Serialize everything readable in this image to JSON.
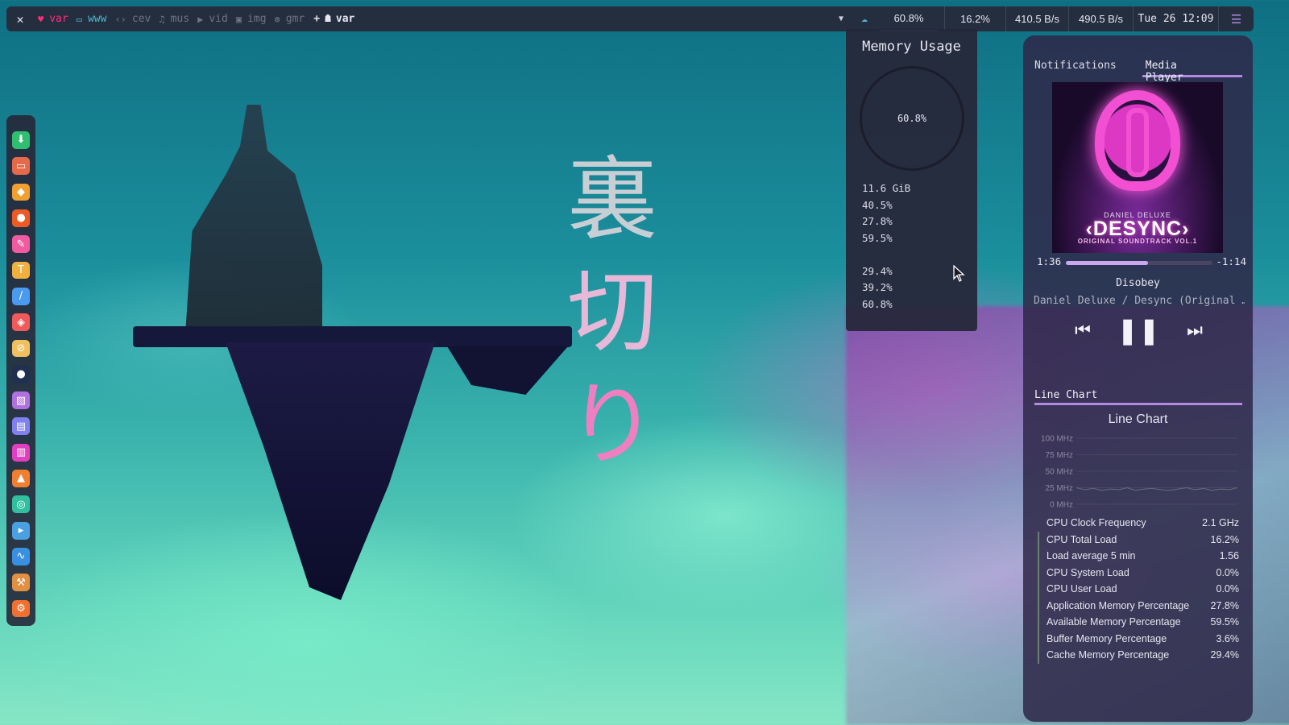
{
  "wallpaper": {
    "kanji": [
      "裏",
      "切",
      "り"
    ]
  },
  "topbar": {
    "workspaces": [
      {
        "icon": "heart-icon",
        "glyph": "♥",
        "label": "var",
        "state": "active"
      },
      {
        "icon": "window-icon",
        "glyph": "▭",
        "label": "www",
        "state": "occupied"
      },
      {
        "icon": "code-icon",
        "glyph": "‹›",
        "label": "cev",
        "state": "empty"
      },
      {
        "icon": "music-icon",
        "glyph": "♫",
        "label": "mus",
        "state": "empty"
      },
      {
        "icon": "video-icon",
        "glyph": "▶",
        "label": "vid",
        "state": "empty"
      },
      {
        "icon": "image-icon",
        "glyph": "▣",
        "label": "img",
        "state": "empty"
      },
      {
        "icon": "gamepad-icon",
        "glyph": "⊛",
        "label": "gmr",
        "state": "empty"
      }
    ],
    "layout_label": "var",
    "memory": "60.8%",
    "cpu": "16.2%",
    "net_down": "410.5 B/s",
    "net_up": "490.5 B/s",
    "clock": "Tue 26  12:09"
  },
  "dock": {
    "items": [
      {
        "icon": "download-icon",
        "glyph": "⬇",
        "color": "#2fbf71"
      },
      {
        "icon": "folder-icon",
        "glyph": "▭",
        "color": "#e46a4a"
      },
      {
        "icon": "brave-icon",
        "glyph": "◆",
        "color": "#f0a030"
      },
      {
        "icon": "firefox-icon",
        "glyph": "●",
        "color": "#ee5a24"
      },
      {
        "icon": "editor-icon",
        "glyph": "✎",
        "color": "#f05aa0"
      },
      {
        "icon": "text-icon",
        "glyph": "T",
        "color": "#f0b040"
      },
      {
        "icon": "brush-icon",
        "glyph": "/",
        "color": "#4a9af0"
      },
      {
        "icon": "git-icon",
        "glyph": "◈",
        "color": "#f05a5a"
      },
      {
        "icon": "tool-icon",
        "glyph": "⊘",
        "color": "#f0c060"
      },
      {
        "icon": "circle-app-icon",
        "glyph": "●",
        "color": "#203050"
      },
      {
        "icon": "image-viewer-icon",
        "glyph": "▧",
        "color": "#b070e0"
      },
      {
        "icon": "camera-icon",
        "glyph": "▤",
        "color": "#8080f0"
      },
      {
        "icon": "mixer-icon",
        "glyph": "▥",
        "color": "#e040c0"
      },
      {
        "icon": "vlc-icon",
        "glyph": "▲",
        "color": "#f08030"
      },
      {
        "icon": "globe-icon",
        "glyph": "◎",
        "color": "#30c0a0"
      },
      {
        "icon": "terminal-icon",
        "glyph": "▸",
        "color": "#4aa0e0"
      },
      {
        "icon": "monitor-icon",
        "glyph": "∿",
        "color": "#3a90e0"
      },
      {
        "icon": "hammer-icon",
        "glyph": "⚒",
        "color": "#e09040"
      },
      {
        "icon": "settings-icon",
        "glyph": "⚙",
        "color": "#f07030"
      }
    ]
  },
  "memory_popup": {
    "title": "Memory Usage",
    "gauge_value": "60.8%",
    "values_a": [
      "11.6 GiB",
      "40.5%",
      "27.8%",
      "59.5%"
    ],
    "values_b": [
      "29.4%",
      "39.2%",
      "60.8%"
    ]
  },
  "sidebar": {
    "tabs": [
      "Notifications",
      "Media Player"
    ],
    "media": {
      "album": {
        "artist_text": "DANIEL DELUXE",
        "title_text": "‹DESYNC›",
        "subtitle_text": "ORIGINAL SOUNDTRACK VOL.1"
      },
      "elapsed": "1:36",
      "remaining": "-1:14",
      "progress": 0.56,
      "track": "Disobey",
      "artist": "Daniel Deluxe / Desync (Original …"
    },
    "chart_tab": "Line Chart",
    "chart_data": {
      "type": "line",
      "title": "Line Chart",
      "ylabel": "",
      "yticks": [
        "100 MHz",
        "75 MHz",
        "50 MHz",
        "25 MHz",
        "0 MHz"
      ],
      "ylim": [
        0,
        100
      ],
      "series": [
        {
          "values": [
            25,
            22,
            24,
            21,
            23,
            22,
            25,
            21,
            23,
            24,
            22,
            21,
            23,
            25,
            22,
            24,
            21,
            23,
            22,
            25
          ]
        }
      ]
    },
    "sensors": [
      {
        "label": "CPU Clock Frequency",
        "value": "2.1 GHz"
      },
      {
        "label": "CPU Total Load",
        "value": "16.2%"
      },
      {
        "label": "Load average 5 min",
        "value": "1.56"
      },
      {
        "label": "CPU System Load",
        "value": "0.0%"
      },
      {
        "label": "CPU User Load",
        "value": "0.0%"
      },
      {
        "label": "Application Memory Percentage",
        "value": "27.8%"
      },
      {
        "label": "Available Memory Percentage",
        "value": "59.5%"
      },
      {
        "label": "Buffer Memory Percentage",
        "value": "3.6%"
      },
      {
        "label": "Cache Memory Percentage",
        "value": "29.4%"
      }
    ]
  }
}
